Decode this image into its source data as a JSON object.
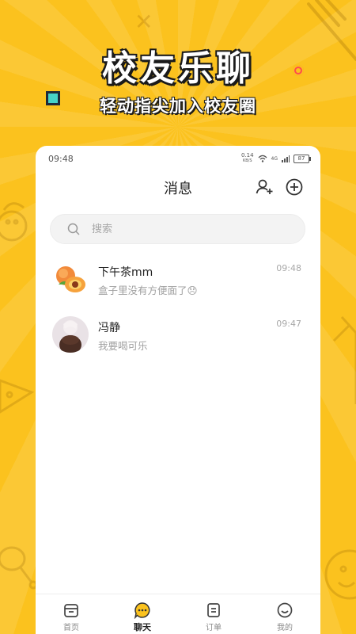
{
  "promo": {
    "headline": "校友乐聊",
    "subline": "轻动指尖加入校友圈"
  },
  "status_bar": {
    "time": "09:48",
    "net_speed": "0.14",
    "net_unit": "KB/S",
    "signal": "4G",
    "battery": "87"
  },
  "header": {
    "title": "消息",
    "add_friend_icon": "add-friend-icon",
    "add_icon": "plus-circle-icon"
  },
  "search": {
    "placeholder": "搜索"
  },
  "chats": [
    {
      "name": "下午茶mm",
      "preview": "盒子里没有方便面了😞",
      "time": "09:48",
      "avatar": "peach-avatar"
    },
    {
      "name": "冯静",
      "preview": "我要喝可乐",
      "time": "09:47",
      "avatar": "photo-avatar"
    }
  ],
  "tabs": [
    {
      "label": "首页",
      "icon": "home-box-icon",
      "active": false
    },
    {
      "label": "聊天",
      "icon": "chat-bubble-icon",
      "active": true
    },
    {
      "label": "订单",
      "icon": "order-list-icon",
      "active": false
    },
    {
      "label": "我的",
      "icon": "smile-face-icon",
      "active": false
    }
  ],
  "colors": {
    "background": "#FBC21E",
    "accent": "#FBC21E",
    "text": "#222222",
    "muted": "#A0A0A0"
  }
}
